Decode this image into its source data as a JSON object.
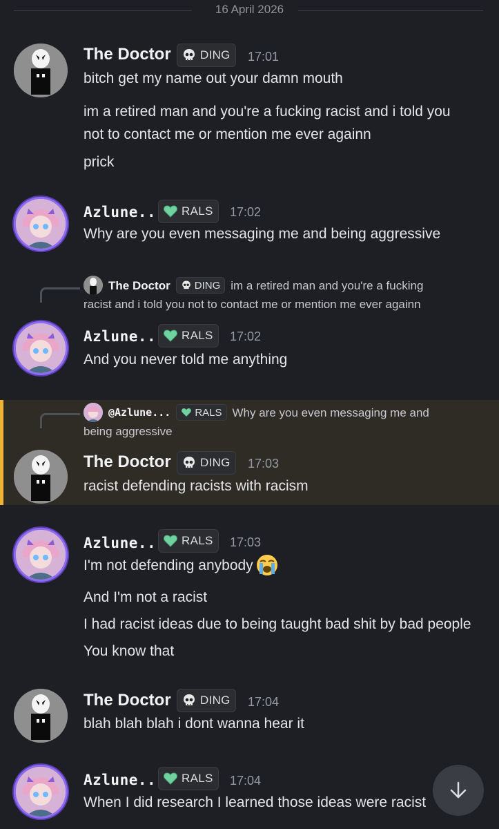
{
  "date_divider": "16 April 2026",
  "users": {
    "doctor": {
      "name": "The Doctor",
      "tag": "DING",
      "tag_icon": "skull-icon"
    },
    "azlune": {
      "name": "Azlune...",
      "mention": "@Azlune...",
      "tag": "RALS",
      "tag_icon": "green-heart-icon"
    }
  },
  "colors": {
    "background": "#1e1f24",
    "highlight": "#2f2c26",
    "highlight_bar": "#f0b232",
    "ring": "#8e6cf0",
    "tag_heart": "#6fd3a0"
  },
  "messages": [
    {
      "author": "The Doctor",
      "tag": "DING",
      "time": "17:01",
      "lines": [
        "bitch get my name out your damn mouth",
        "im a retired man and you're a fucking racist and i told you",
        "not to contact me or mention me ever againn",
        "prick"
      ]
    },
    {
      "author": "Azlune...",
      "tag": "RALS",
      "time": "17:02",
      "lines": [
        "Why are you even messaging me and being aggressive"
      ]
    },
    {
      "author": "Azlune...",
      "tag": "RALS",
      "time": "17:02",
      "reply": {
        "author": "The Doctor",
        "tag": "DING",
        "text_line1": "im a retired man and you're a fucking",
        "text_line2": "racist and i told you not to contact me or mention me ever againn"
      },
      "lines": [
        "And you never told me anything"
      ]
    },
    {
      "author": "The Doctor",
      "tag": "DING",
      "time": "17:03",
      "reply": {
        "author": "@Azlune...",
        "tag": "RALS",
        "text_line1": "Why are you even messaging me and",
        "text_line2": "being aggressive"
      },
      "lines": [
        "racist defending racists with racism"
      ]
    },
    {
      "author": "Azlune...",
      "tag": "RALS",
      "time": "17:03",
      "lines": [
        "I'm not defending anybody",
        "And I'm not a racist",
        "I had racist ideas due to being taught bad shit by bad people",
        "You know that"
      ],
      "emoji": "loudly-crying-face-icon"
    },
    {
      "author": "The Doctor",
      "tag": "DING",
      "time": "17:04",
      "lines": [
        "blah blah blah i dont wanna hear it"
      ]
    },
    {
      "author": "Azlune...",
      "tag": "RALS",
      "time": "17:04",
      "lines": [
        "When I did research I learned those ideas were racist"
      ]
    }
  ],
  "scroll_button": {
    "icon": "arrow-down-icon"
  }
}
